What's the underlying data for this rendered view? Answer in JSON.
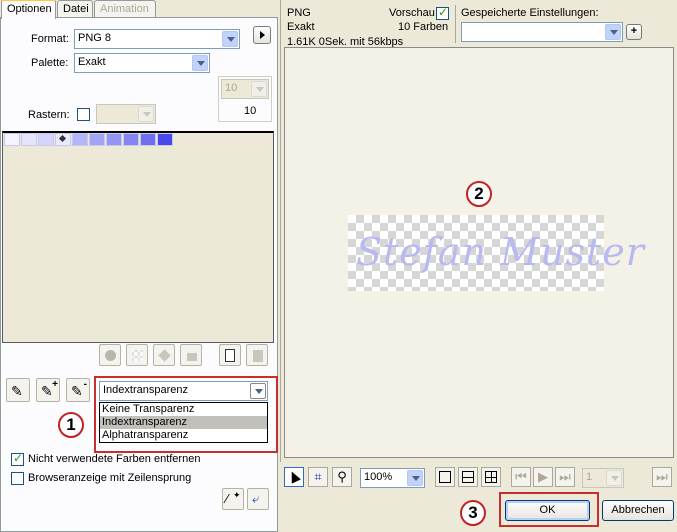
{
  "tabs": [
    {
      "label": "Optionen",
      "state": "active"
    },
    {
      "label": "Datei",
      "state": "normal"
    },
    {
      "label": "Animation",
      "state": "disabled"
    }
  ],
  "options": {
    "format_label": "Format:",
    "format_value": "PNG 8",
    "palette_label": "Palette:",
    "palette_value": "Exakt",
    "colors_value": "10",
    "colors_count": "10",
    "raster_label": "Rastern:"
  },
  "swatch_colors": [
    "#f4f4ff",
    "#e4e4ff",
    "#d4d4fc",
    "#e8e8fe",
    "#b4b4f8",
    "#a4a4f6",
    "#9494f4",
    "#8484f2",
    "#7070ee",
    "#4848e8"
  ],
  "transparency": {
    "selected": "Indextransparenz",
    "options": [
      "Keine Transparenz",
      "Indextransparenz",
      "Alphatransparenz"
    ],
    "highlighted_index": 1
  },
  "checkboxes": {
    "remove_unused": {
      "label": "Nicht verwendete Farben entfernen",
      "checked": true
    },
    "interlaced": {
      "label": "Browseranzeige mit Zeilensprung",
      "checked": false
    }
  },
  "preview_info": {
    "format": "PNG",
    "palette": "Exakt",
    "stats": "1.61K  0Sek. mit 56kbps",
    "preview_label": "Vorschau",
    "colors": "10 Farben",
    "saved_settings_label": "Gespeicherte Einstellungen:"
  },
  "preview_text": "Stefan Muster",
  "zoom": "100%",
  "frame_value": "1",
  "buttons": {
    "ok": "OK",
    "cancel": "Abbrechen",
    "add": "+"
  },
  "badges": [
    "1",
    "2",
    "3"
  ],
  "colors": {
    "accent_red": "#c62f2f",
    "preview_bg": "#f4f2e6",
    "signature": "#b9b9f2"
  }
}
